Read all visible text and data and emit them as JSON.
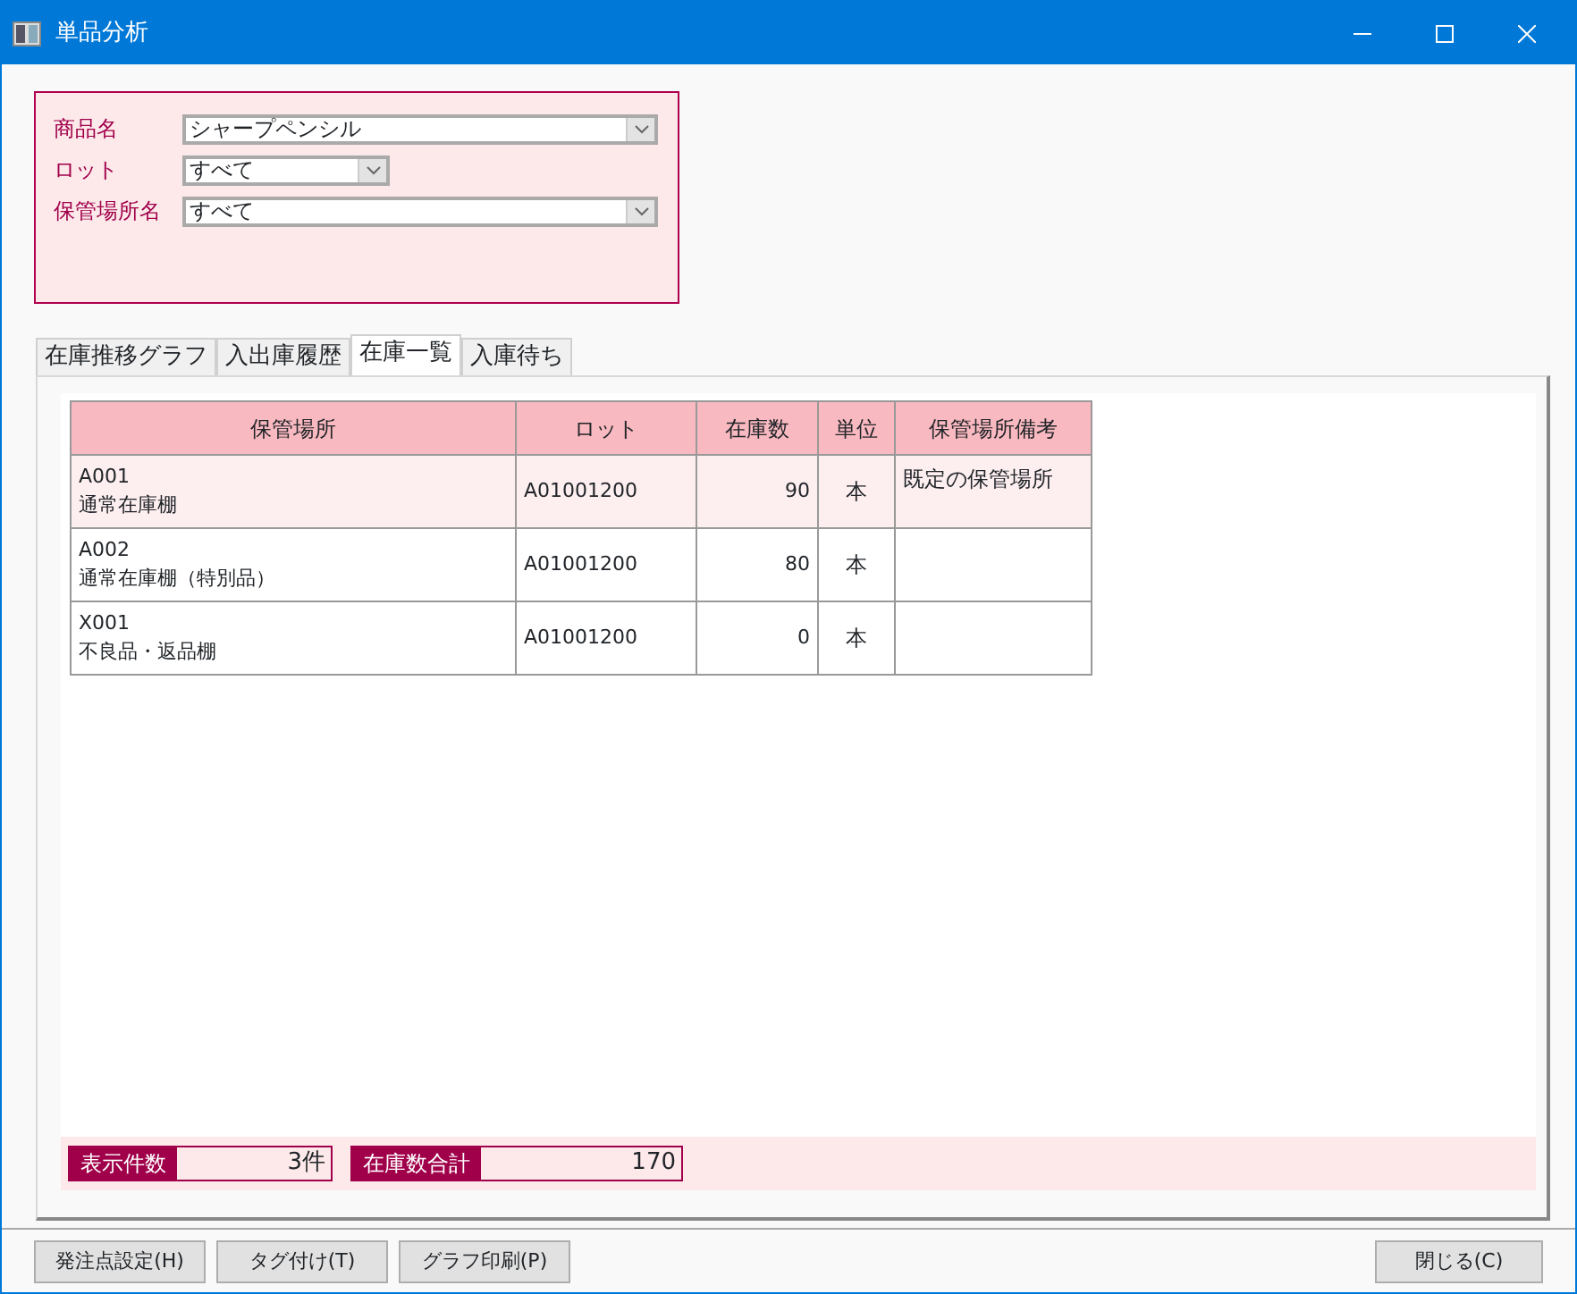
{
  "window": {
    "title": "単品分析"
  },
  "filters": [
    {
      "label": "商品名",
      "value": "シャープペンシル",
      "kind": "wide"
    },
    {
      "label": "ロット",
      "value": "すべて",
      "kind": "narrow"
    },
    {
      "label": "保管場所名",
      "value": "すべて",
      "kind": "wide"
    }
  ],
  "tabs": [
    {
      "label": "在庫推移グラフ",
      "selected": false
    },
    {
      "label": "入出庫履歴",
      "selected": false
    },
    {
      "label": "在庫一覧",
      "selected": true
    },
    {
      "label": "入庫待ち",
      "selected": false
    }
  ],
  "table": {
    "columns": [
      "保管場所",
      "ロット",
      "在庫数",
      "単位",
      "保管場所備考"
    ],
    "rows": [
      {
        "selected": true,
        "cells": [
          "A001\n通常在庫棚",
          "A01001200",
          "90",
          "本",
          "既定の保管場所"
        ]
      },
      {
        "selected": false,
        "cells": [
          "A002\n通常在庫棚（特別品）",
          "A01001200",
          "80",
          "本",
          ""
        ]
      },
      {
        "selected": false,
        "cells": [
          "X001\n不良品・返品棚",
          "A01001200",
          "0",
          "本",
          ""
        ]
      }
    ]
  },
  "summary": [
    {
      "label": "表示件数",
      "value": "3件"
    },
    {
      "label": "在庫数合計",
      "value": "170"
    }
  ],
  "buttons_left": [
    "発注点設定(H)",
    "タグ付け(T)",
    "グラフ印刷(P)"
  ],
  "buttons_right": [
    "閉じる(C)"
  ]
}
